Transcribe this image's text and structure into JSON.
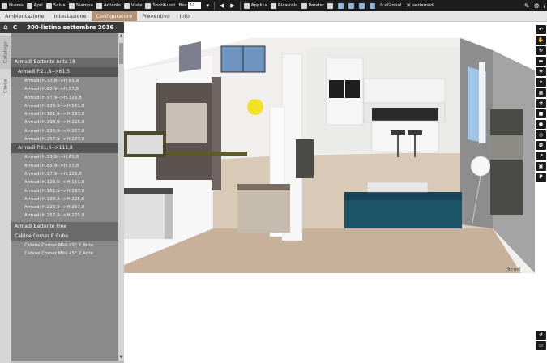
{
  "toolbar": {
    "new_label": "Nuovo",
    "open_label": "Apri",
    "save_label": "Salva",
    "print_label": "Stampa",
    "article_label": "Articolo",
    "views_label": "Viste",
    "replace_label": "Sostituisci",
    "box_label": "Box",
    "box_value": "52",
    "apply_label": "Applica",
    "recalc_label": "Ricalcola",
    "render_label": "Render",
    "global_label": "0 oGlobal",
    "user_label": "seriamod"
  },
  "menu": {
    "tabs": [
      "Ambientazione",
      "Intestazione",
      "Configuratore",
      "Preventivo",
      "Info"
    ],
    "active": "Configuratore"
  },
  "left_panel": {
    "code": "C",
    "title": "300-listino settembre 2016",
    "tab_catalog": "Catalogo",
    "tab_search": "Cerca",
    "group1": "Armadi Battente Anta 18",
    "sub1": "Armadi P.21,8-->61,5",
    "sub1_items": [
      "Armadi H.33,8-->H.65,8",
      "Armadi H.65,9-->H.97,8",
      "Armadi H.97,9-->H.129,8",
      "Armadi H.129,9-->H.161,8",
      "Armadi H.161,9-->H.193,8",
      "Armadi H.193,9-->H.225,8",
      "Armadi H.225,9-->H.257,8",
      "Armadi H.257,9-->H.273,8"
    ],
    "sub2": "Armadi P.61,6-->111,8",
    "sub2_items": [
      "Armadi H.33,8-->H.65,8",
      "Armadi H.65,9-->H.97,8",
      "Armadi H.97,9-->H.129,8",
      "Armadi H.129,9-->H.161,8",
      "Armadi H.161,9-->H.193,8",
      "Armadi H.193,9-->H.225,8",
      "Armadi H.225,9-->H.257,8",
      "Armadi H.257,9-->H.273,8"
    ],
    "group2": "Armadi Battente Free",
    "group3": "Cabine Corner E Cubo",
    "group3_items": [
      "Cabine Corner Mini 45° 1 Anta",
      "Cabine Corner Mini 45° 2 Ante"
    ]
  },
  "viewport": {
    "watermark": "3cad"
  },
  "right_tools": {
    "dimension_label": "D",
    "perspective_label": "P"
  }
}
